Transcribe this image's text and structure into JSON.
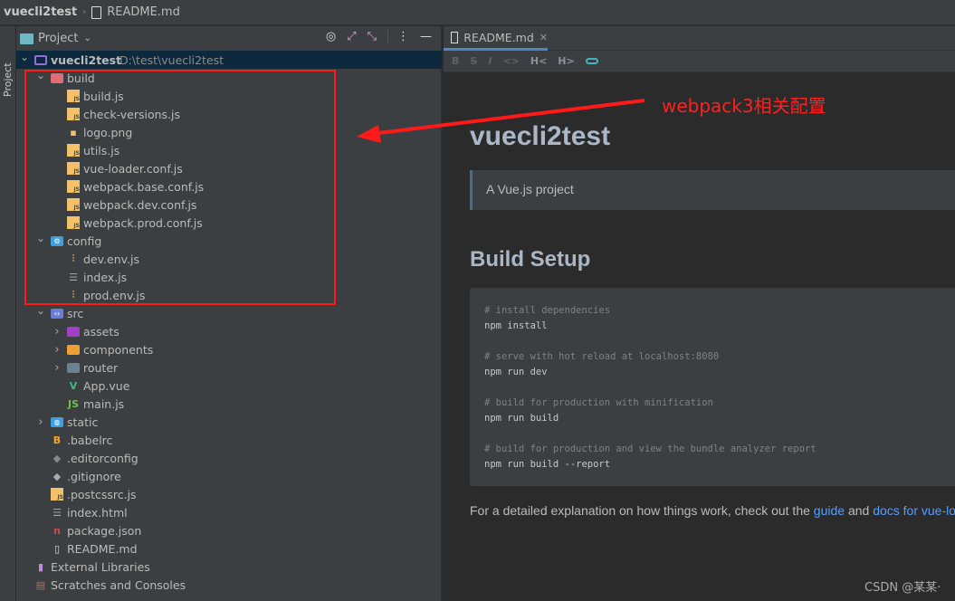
{
  "breadcrumb": {
    "project": "vuecli2test",
    "file": "README.md"
  },
  "side_strip": {
    "label": "Project"
  },
  "panel": {
    "title": "Project"
  },
  "tree": [
    {
      "label": "vuecli2test",
      "path": "D:\\test\\vuecli2test",
      "level": 0,
      "chev": "down",
      "icon": "folder-icon",
      "color": "#8f6fd8",
      "selected": true
    },
    {
      "label": "build",
      "level": 1,
      "chev": "down",
      "icon": "folder-icon",
      "color": "#e06c75"
    },
    {
      "label": "build.js",
      "level": 2,
      "icon": "js-file-icon",
      "color": "#f4c06a"
    },
    {
      "label": "check-versions.js",
      "level": 2,
      "icon": "js-file-icon",
      "color": "#f4c06a"
    },
    {
      "label": "logo.png",
      "level": 2,
      "icon": "image-file-icon",
      "color": "#f4c06a"
    },
    {
      "label": "utils.js",
      "level": 2,
      "icon": "js-file-icon",
      "color": "#f4c06a"
    },
    {
      "label": "vue-loader.conf.js",
      "level": 2,
      "icon": "js-file-icon",
      "color": "#f4c06a"
    },
    {
      "label": "webpack.base.conf.js",
      "level": 2,
      "icon": "js-file-icon",
      "color": "#f4c06a"
    },
    {
      "label": "webpack.dev.conf.js",
      "level": 2,
      "icon": "js-file-icon",
      "color": "#f4c06a"
    },
    {
      "label": "webpack.prod.conf.js",
      "level": 2,
      "icon": "js-file-icon",
      "color": "#f4c06a"
    },
    {
      "label": "config",
      "level": 1,
      "chev": "down",
      "icon": "config-folder-icon",
      "color": "#3d9ee0"
    },
    {
      "label": "dev.env.js",
      "level": 2,
      "icon": "settings-file-icon",
      "color": "#e0a33d"
    },
    {
      "label": "index.js",
      "level": 2,
      "icon": "list-file-icon",
      "color": "#9aa7b0"
    },
    {
      "label": "prod.env.js",
      "level": 2,
      "icon": "settings-file-icon",
      "color": "#e0a33d"
    },
    {
      "label": "src",
      "level": 1,
      "chev": "down",
      "icon": "source-folder-icon",
      "color": "#6a7bd8"
    },
    {
      "label": "assets",
      "level": 2,
      "chev": "right",
      "icon": "folder-icon",
      "color": "#a23fc4"
    },
    {
      "label": "components",
      "level": 2,
      "chev": "right",
      "icon": "folder-icon",
      "color": "#f0a030"
    },
    {
      "label": "router",
      "level": 2,
      "chev": "right",
      "icon": "folder-icon",
      "color": "#6c8290"
    },
    {
      "label": "App.vue",
      "level": 2,
      "icon": "vue-file-icon",
      "color": "#41b883"
    },
    {
      "label": "main.js",
      "level": 2,
      "icon": "nodejs-file-icon",
      "color": "#6cc24a"
    },
    {
      "label": "static",
      "level": 1,
      "chev": "right",
      "icon": "web-folder-icon",
      "color": "#3d9ee0"
    },
    {
      "label": ".babelrc",
      "level": 1,
      "icon": "babel-file-icon",
      "color": "#f5a623"
    },
    {
      "label": ".editorconfig",
      "level": 1,
      "icon": "editorconfig-file-icon",
      "color": "#888888"
    },
    {
      "label": ".gitignore",
      "level": 1,
      "icon": "git-file-icon",
      "color": "#aaaaaa"
    },
    {
      "label": ".postcssrc.js",
      "level": 1,
      "icon": "js-file-icon",
      "color": "#f4c06a"
    },
    {
      "label": "index.html",
      "level": 1,
      "icon": "html-file-icon",
      "color": "#9aa7b0"
    },
    {
      "label": "package.json",
      "level": 1,
      "icon": "npm-file-icon",
      "color": "#d34a4a"
    },
    {
      "label": "README.md",
      "level": 1,
      "icon": "markdown-file-icon",
      "color": "#dddddd"
    },
    {
      "label": "External Libraries",
      "level": 0.5,
      "icon": "library-icon",
      "color": "#c08ad8"
    },
    {
      "label": "Scratches and Consoles",
      "level": 0.5,
      "icon": "scratches-icon",
      "color": "#a9745c"
    }
  ],
  "editor": {
    "tab": "README.md",
    "toolbar": [
      "B",
      "S",
      "I",
      "<>",
      "H<",
      "H>",
      "link"
    ],
    "h1": "vuecli2test",
    "quote": "A Vue.js project",
    "h2": "Build Setup",
    "code": [
      {
        "comment": "# install dependencies",
        "cmd": "npm install"
      },
      {
        "comment": "# serve with hot reload at localhost:8080",
        "cmd": "npm run dev"
      },
      {
        "comment": "# build for production with minification",
        "cmd": "npm run build"
      },
      {
        "comment": "# build for production and view the bundle analyzer report",
        "cmd": "npm run build --report"
      }
    ],
    "para": {
      "text": "For a detailed explanation on how things work, check out the ",
      "link1": "guide",
      "mid": " and ",
      "link2": "docs for vue-lo"
    }
  },
  "annotation": {
    "text": "webpack3相关配置",
    "color": "#ff2020"
  },
  "watermark": "CSDN @某某·"
}
